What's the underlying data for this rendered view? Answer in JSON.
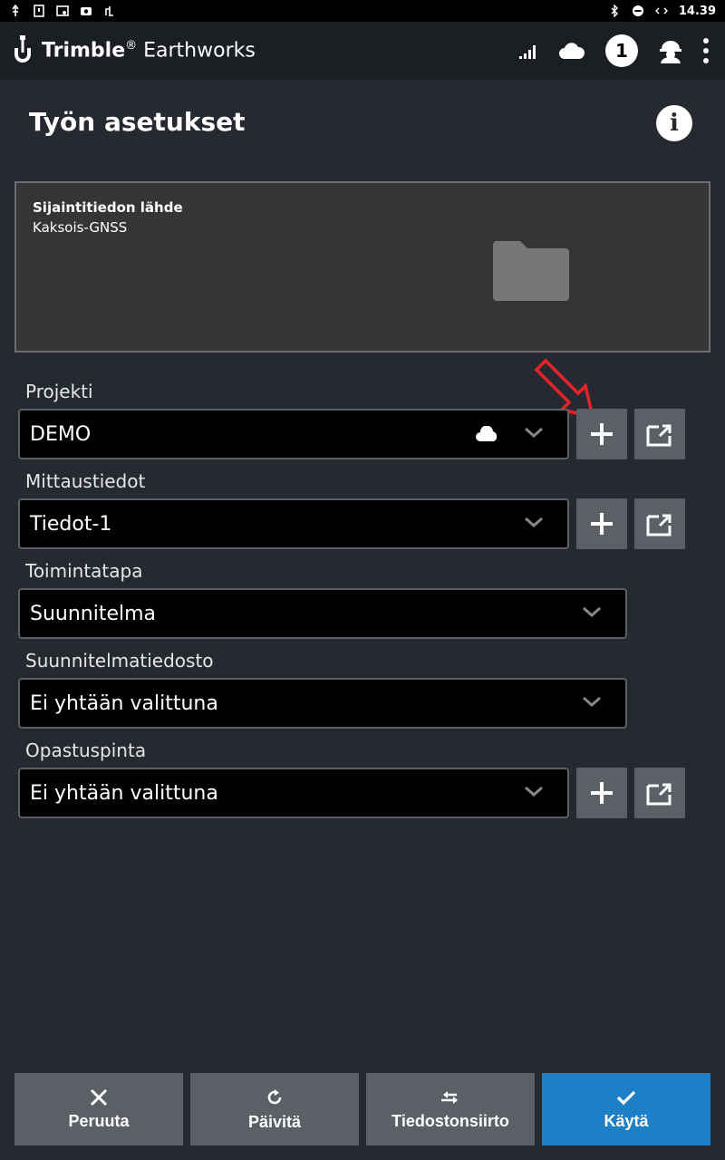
{
  "status_bar": {
    "time": "14.39"
  },
  "app": {
    "brand": "Trimble",
    "brand_reg": "®",
    "product": "Earthworks",
    "notification_count": "1"
  },
  "page": {
    "title": "Työn asetukset"
  },
  "source": {
    "label": "Sijaintitiedon lähde",
    "value": "Kaksois-GNSS"
  },
  "fields": {
    "projekti": {
      "label": "Projekti",
      "value": "DEMO"
    },
    "mittaustiedot": {
      "label": "Mittaustiedot",
      "value": "Tiedot-1"
    },
    "toimintatapa": {
      "label": "Toimintatapa",
      "value": "Suunnitelma"
    },
    "suunnitelmatiedosto": {
      "label": "Suunnitelmatiedosto",
      "value": "Ei yhtään valittuna"
    },
    "opastuspinta": {
      "label": "Opastuspinta",
      "value": "Ei yhtään valittuna"
    }
  },
  "buttons": {
    "cancel": "Peruuta",
    "refresh": "Päivitä",
    "transfer": "Tiedostonsiirto",
    "apply": "Käytä"
  },
  "colors": {
    "accent": "#1e7fc6",
    "annotation_arrow": "#e8222a"
  }
}
